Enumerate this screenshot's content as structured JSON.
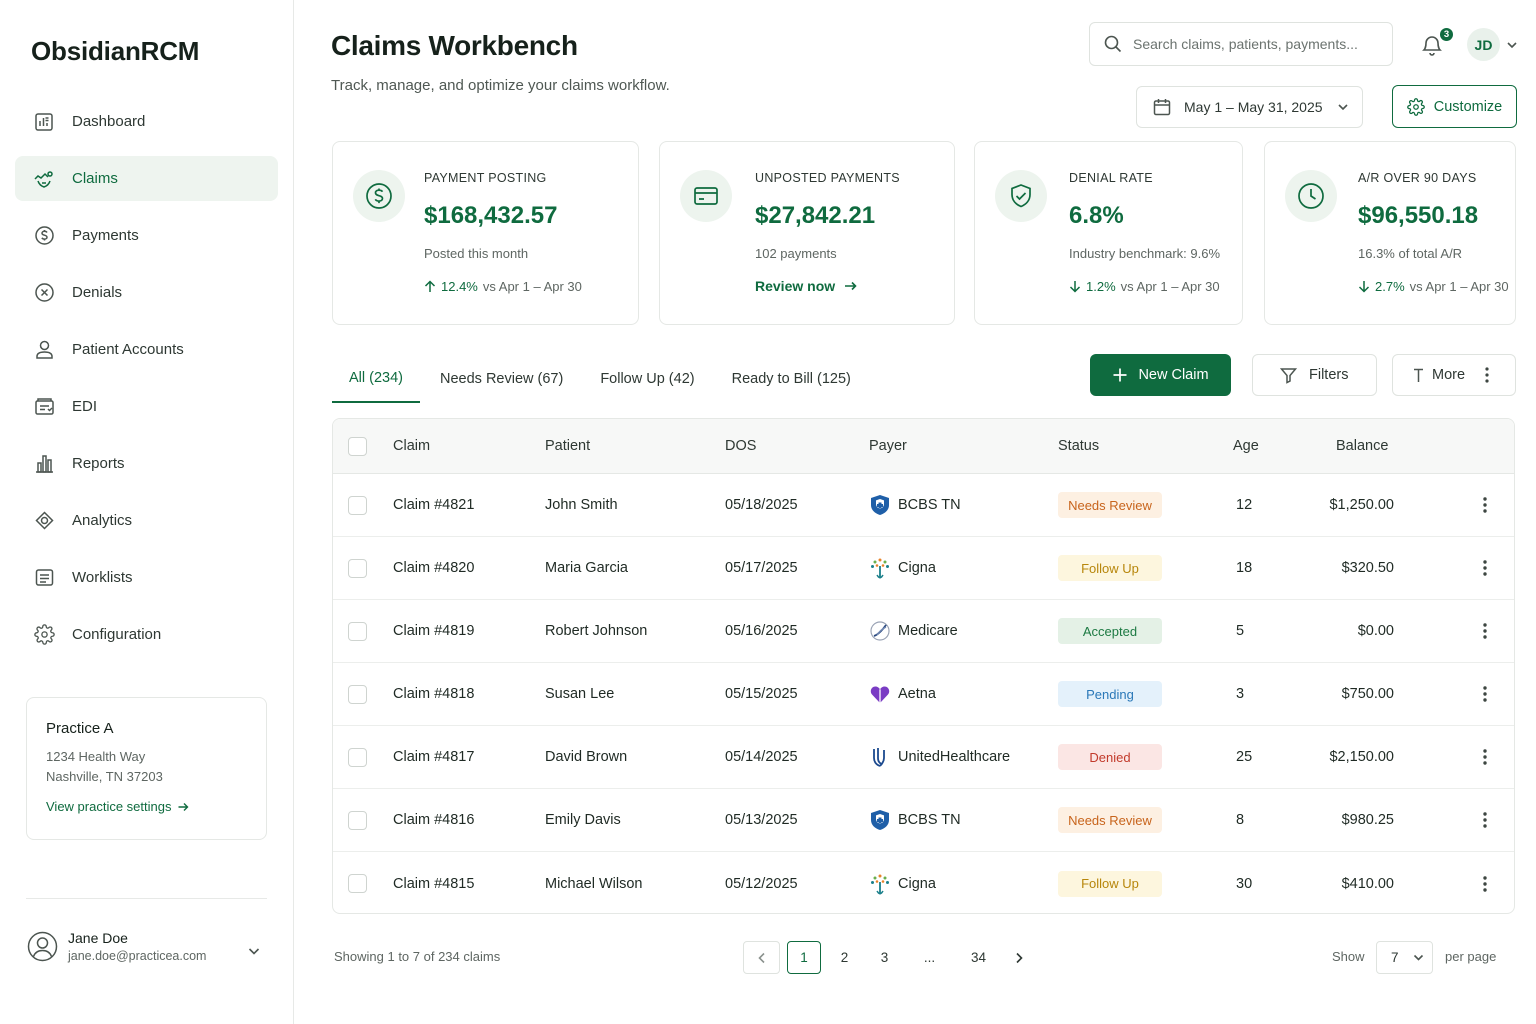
{
  "app": {
    "brand": "ObsidianRCM"
  },
  "sidebar": {
    "items": [
      {
        "label": "Dashboard",
        "icon": "dashboard-icon"
      },
      {
        "label": "Claims",
        "icon": "claims-icon",
        "active": true
      },
      {
        "label": "Payments",
        "icon": "dollar-circle-icon"
      },
      {
        "label": "Denials",
        "icon": "x-circle-icon"
      },
      {
        "label": "Patient Accounts",
        "icon": "user-icon"
      },
      {
        "label": "EDI",
        "icon": "edi-icon"
      },
      {
        "label": "Reports",
        "icon": "bar-chart-icon"
      },
      {
        "label": "Analytics",
        "icon": "analytics-icon"
      },
      {
        "label": "Worklists",
        "icon": "list-icon"
      },
      {
        "label": "Configuration",
        "icon": "gear-icon"
      }
    ],
    "practice": {
      "name": "Practice A",
      "address1": "1234 Health Way",
      "address2": "Nashville, TN 37203",
      "link": "View practice settings"
    },
    "user": {
      "name": "Jane Doe",
      "email": "jane.doe@practicea.com"
    }
  },
  "header": {
    "title": "Claims Workbench",
    "subtitle": "Track, manage, and optimize your claims workflow.",
    "search_placeholder": "Search claims, patients, payments...",
    "notification_count": "3",
    "avatar_initials": "JD",
    "date_range": "May 1 – May 31, 2025",
    "customize_label": "Customize"
  },
  "kpis": {
    "payment_posting": {
      "label": "PAYMENT POSTING",
      "value": "$168,432.57",
      "note": "Posted this month",
      "trend_pct": "12.4%",
      "trend_text": "vs Apr 1 – Apr 30",
      "direction": "up"
    },
    "unposted_payments": {
      "label": "UNPOSTED PAYMENTS",
      "value": "$27,842.21",
      "note": "102 payments",
      "link": "Review now"
    },
    "denial_rate": {
      "label": "DENIAL RATE",
      "value": "6.8%",
      "note": "Industry benchmark: 9.6%",
      "trend_pct": "1.2%",
      "trend_text": "vs Apr 1 – Apr 30",
      "direction": "down"
    },
    "ar_over_90": {
      "label": "A/R OVER 90 DAYS",
      "value": "$96,550.18",
      "note": "16.3% of total A/R",
      "trend_pct": "2.7%",
      "trend_text": "vs Apr 1 – Apr 30",
      "direction": "down"
    }
  },
  "tabs": [
    {
      "label": "All (234)",
      "active": true
    },
    {
      "label": "Needs Review (67)"
    },
    {
      "label": "Follow Up (42)"
    },
    {
      "label": "Ready to Bill (125)"
    }
  ],
  "actions": {
    "new_claim": "New Claim",
    "filters": "Filters",
    "more": "More"
  },
  "table": {
    "columns": [
      "Claim",
      "Patient",
      "DOS",
      "Payer",
      "Status",
      "Age",
      "Balance"
    ],
    "rows": [
      {
        "claim": "Claim #4821",
        "patient": "John Smith",
        "dos": "05/18/2025",
        "payer": "BCBS TN",
        "status": "Needs Review",
        "age": "12",
        "balance": "$1,250.00"
      },
      {
        "claim": "Claim #4820",
        "patient": "Maria Garcia",
        "dos": "05/17/2025",
        "payer": "Cigna",
        "status": "Follow Up",
        "age": "18",
        "balance": "$320.50"
      },
      {
        "claim": "Claim #4819",
        "patient": "Robert Johnson",
        "dos": "05/16/2025",
        "payer": "Medicare",
        "status": "Accepted",
        "age": "5",
        "balance": "$0.00"
      },
      {
        "claim": "Claim #4818",
        "patient": "Susan Lee",
        "dos": "05/15/2025",
        "payer": "Aetna",
        "status": "Pending",
        "age": "3",
        "balance": "$750.00"
      },
      {
        "claim": "Claim #4817",
        "patient": "David Brown",
        "dos": "05/14/2025",
        "payer": "UnitedHealthcare",
        "status": "Denied",
        "age": "25",
        "balance": "$2,150.00"
      },
      {
        "claim": "Claim #4816",
        "patient": "Emily Davis",
        "dos": "05/13/2025",
        "payer": "BCBS TN",
        "status": "Needs Review",
        "age": "8",
        "balance": "$980.25"
      },
      {
        "claim": "Claim #4815",
        "patient": "Michael Wilson",
        "dos": "05/12/2025",
        "payer": "Cigna",
        "status": "Follow Up",
        "age": "30",
        "balance": "$410.00"
      }
    ]
  },
  "status_colors": {
    "Needs Review": {
      "bg": "#fdf0e2",
      "fg": "#c8641c"
    },
    "Follow Up": {
      "bg": "#fdf6de",
      "fg": "#b7860b"
    },
    "Accepted": {
      "bg": "#e4f1e6",
      "fg": "#1d7a43"
    },
    "Pending": {
      "bg": "#e4f1fb",
      "fg": "#2a78b8"
    },
    "Denied": {
      "bg": "#fbe6e4",
      "fg": "#c23a2b"
    }
  },
  "pagination": {
    "showing": "Showing 1 to 7 of 234 claims",
    "pages": [
      "1",
      "2",
      "3",
      "...",
      "34"
    ],
    "current": "1",
    "show_label": "Show",
    "per_page_value": "7",
    "per_page_label": "per page"
  }
}
